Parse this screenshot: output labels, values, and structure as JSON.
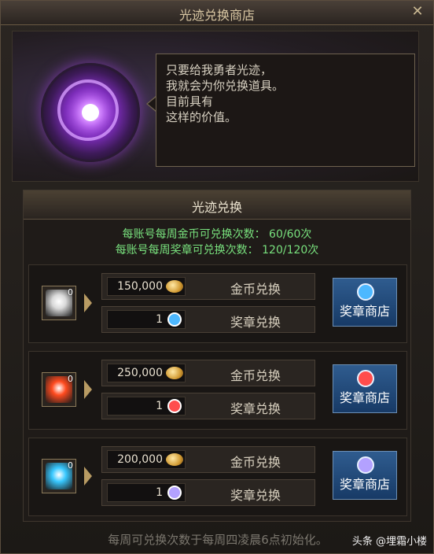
{
  "window": {
    "title": "光迹兑换商店"
  },
  "speech": {
    "lines": [
      "只要给我勇者光迹，",
      "我就会为你兑换道具。",
      "目前具有",
      "这样的价值。"
    ]
  },
  "section": {
    "title": "光迹兑换",
    "limits": [
      "每账号每周金币可兑换次数： 60/60次",
      "每账号每周奖章可兑换次数： 120/120次"
    ]
  },
  "rows": [
    {
      "item_count": "0",
      "item_color": "#d9d9d9",
      "gold_price": "150,000",
      "gold_label": "金币兑换",
      "medal_price": "1",
      "medal_color": "#4db8ff",
      "medal_label": "奖章兑换",
      "shop_label": "奖章商店"
    },
    {
      "item_count": "0",
      "item_color": "#ff4b1f",
      "gold_price": "250,000",
      "gold_label": "金币兑换",
      "medal_price": "1",
      "medal_color": "#ff4d4d",
      "medal_label": "奖章兑换",
      "shop_label": "奖章商店"
    },
    {
      "item_count": "0",
      "item_color": "#38c8ff",
      "gold_price": "200,000",
      "gold_label": "金币兑换",
      "medal_price": "1",
      "medal_color": "#b3a1ff",
      "medal_label": "奖章兑换",
      "shop_label": "奖章商店"
    }
  ],
  "footer": "每周可兑换次数于每周四凌晨6点初始化。",
  "watermark": "头条 @埋霜小楼"
}
